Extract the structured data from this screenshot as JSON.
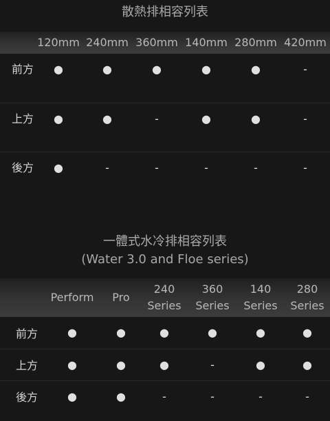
{
  "table1": {
    "title": "散熱排相容列表",
    "columns": [
      "",
      "120mm",
      "240mm",
      "360mm",
      "140mm",
      "280mm",
      "420mm"
    ],
    "rows": [
      {
        "label": "前方",
        "values": [
          "●",
          "●",
          "●",
          "●",
          "●",
          "-"
        ]
      },
      {
        "label": "上方",
        "values": [
          "●",
          "●",
          "-",
          "●",
          "●",
          "-"
        ]
      },
      {
        "label": "後方",
        "values": [
          "●",
          "-",
          "-",
          "-",
          "-",
          "-"
        ]
      }
    ]
  },
  "table2": {
    "title": "一體式水冷排相容列表",
    "subtitle": "(Water 3.0 and Floe series)",
    "columns": [
      "",
      "Perform",
      "Pro",
      "240 Series",
      "360 Series",
      "140 Series",
      "280 Series"
    ],
    "rows": [
      {
        "label": "前方",
        "values": [
          "●",
          "●",
          "●",
          "●",
          "●",
          "●"
        ]
      },
      {
        "label": "上方",
        "values": [
          "●",
          "●",
          "●",
          "-",
          "●",
          "●"
        ]
      },
      {
        "label": "後方",
        "values": [
          "●",
          "●",
          "-",
          "-",
          "-",
          "-"
        ]
      }
    ]
  }
}
